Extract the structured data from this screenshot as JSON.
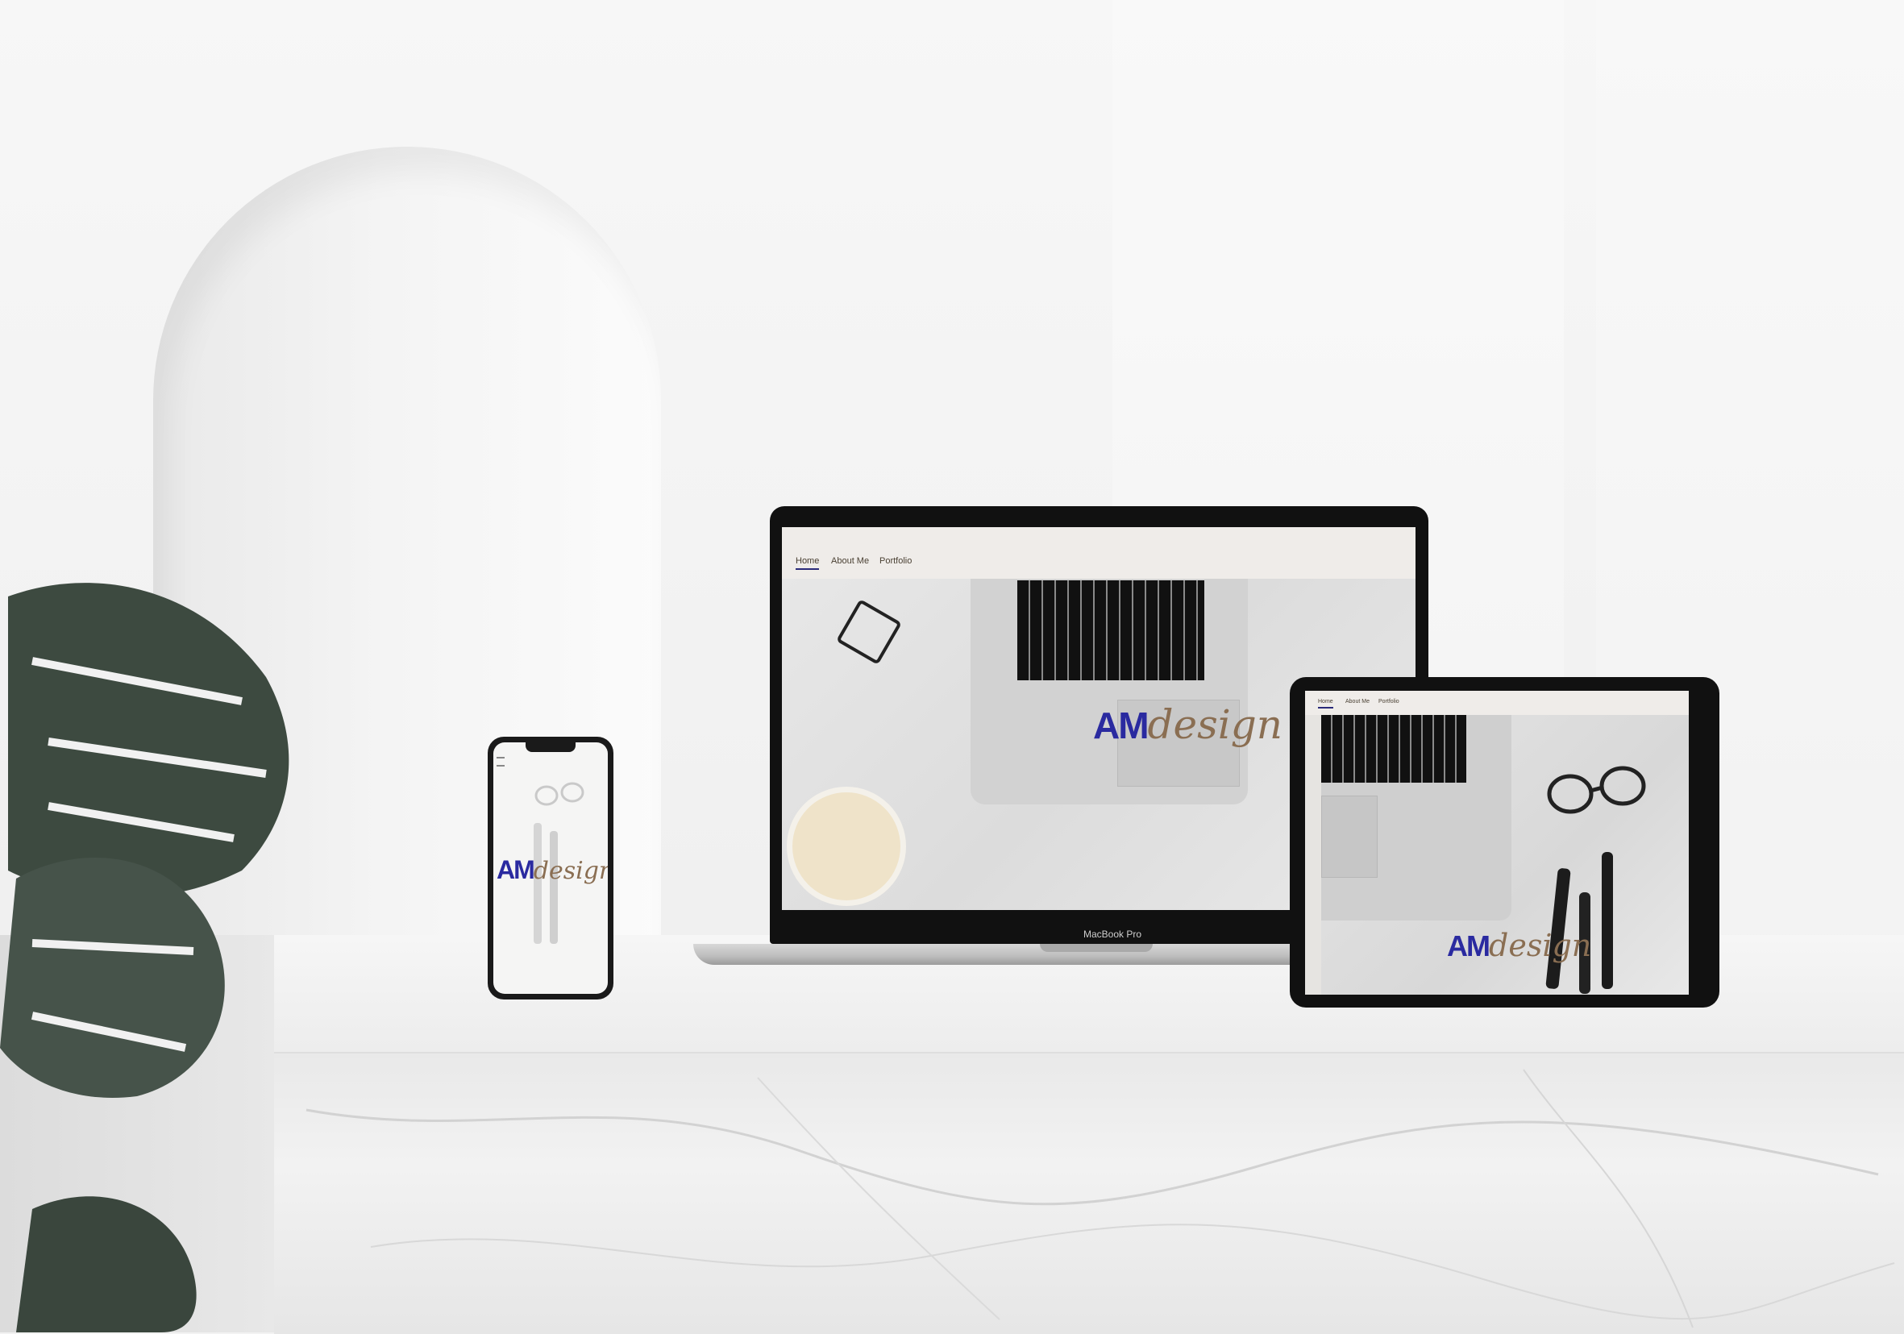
{
  "laptop": {
    "nav": [
      "Home",
      "About Me",
      "Portfolio"
    ],
    "logo_am": "AM",
    "logo_design": "design",
    "brand": "MacBook Pro"
  },
  "tablet": {
    "nav": [
      "Home",
      "About Me",
      "Portfolio"
    ],
    "logo_am": "AM",
    "logo_design": "design"
  },
  "phone": {
    "logo_am": "AM",
    "logo_design": "design",
    "menu_icon": "menu-icon"
  },
  "colors": {
    "logo_am": "#2a2aa0",
    "logo_design": "#8a6e52",
    "nav_background": "#efece9",
    "device_frame": "#111111",
    "plant": "#3d4a40"
  }
}
